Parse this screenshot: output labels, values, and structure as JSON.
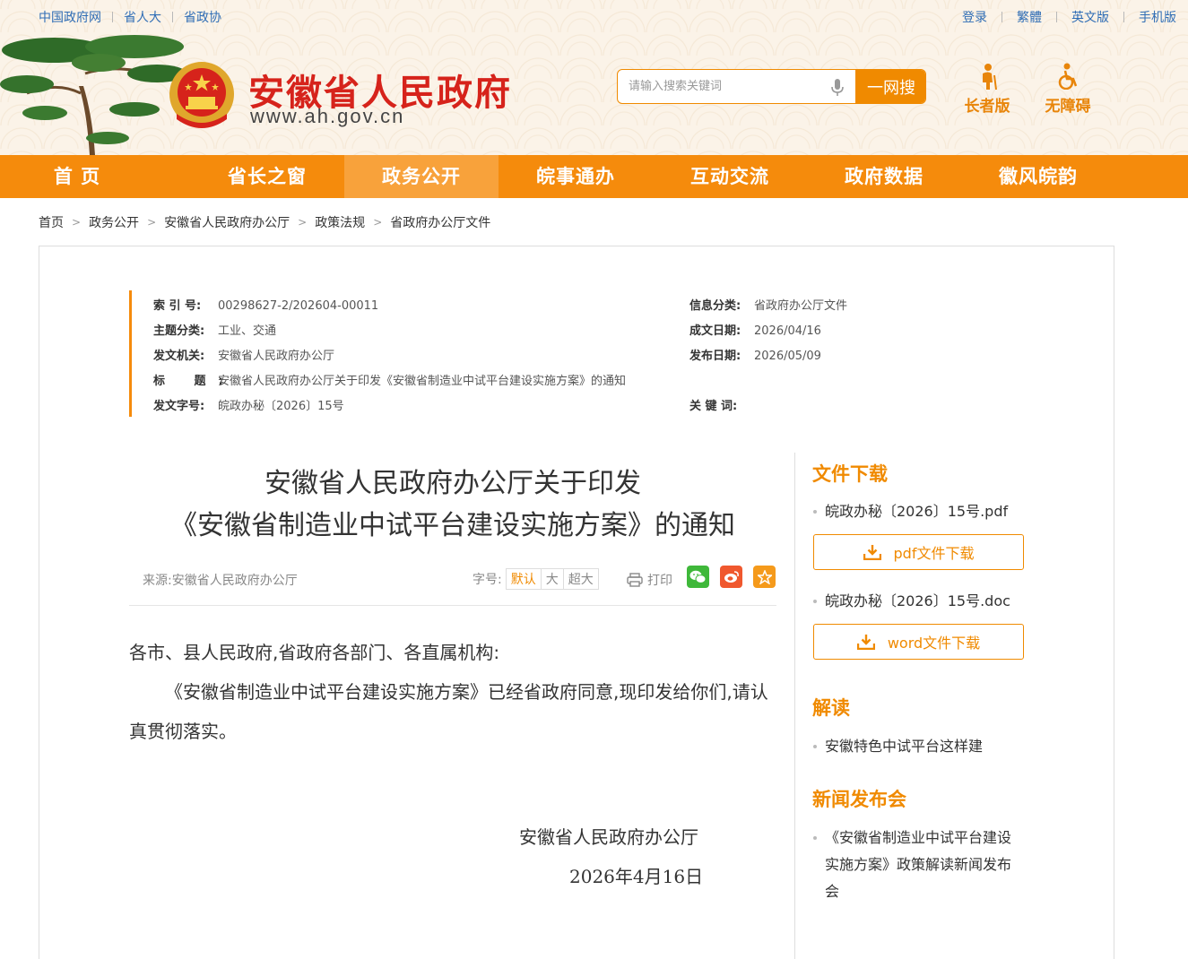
{
  "top_links_left": [
    "中国政府网",
    "省人大",
    "省政协"
  ],
  "top_links_right": [
    "登录",
    "繁體",
    "英文版",
    "手机版"
  ],
  "site": {
    "name": "安徽省人民政府",
    "url": "www.ah.gov.cn"
  },
  "search": {
    "placeholder": "请输入搜索关键词",
    "button": "一网搜"
  },
  "modes": {
    "elder": "长者版",
    "accessible": "无障碍"
  },
  "nav": {
    "items": [
      "首 页",
      "省长之窗",
      "政务公开",
      "皖事通办",
      "互动交流",
      "政府数据",
      "徽风皖韵"
    ],
    "active": "政务公开"
  },
  "breadcrumb": [
    "首页",
    "政务公开",
    "安徽省人民政府办公厅",
    "政策法规",
    "省政府办公厅文件"
  ],
  "meta": {
    "index_no": {
      "label": "索 引 号:",
      "value": "00298627-2/202604-00011"
    },
    "topic": {
      "label": "主题分类:",
      "value": "工业、交通"
    },
    "issuer": {
      "label": "发文机关:",
      "value": "安徽省人民政府办公厅"
    },
    "title": {
      "label": "标 题:",
      "value": "安徽省人民政府办公厅关于印发《安徽省制造业中试平台建设实施方案》的通知"
    },
    "doc_no": {
      "label": "发文字号:",
      "value": "皖政办秘〔2026〕15号"
    },
    "info_category": {
      "label": "信息分类:",
      "value": "省政府办公厅文件"
    },
    "created": {
      "label": "成文日期:",
      "value": "2026/04/16"
    },
    "published": {
      "label": "发布日期:",
      "value": "2026/05/09"
    },
    "keywords": {
      "label": "关 键 词:",
      "value": ""
    }
  },
  "article": {
    "title_line1": "安徽省人民政府办公厅关于印发",
    "title_line2": "《安徽省制造业中试平台建设实施方案》的通知",
    "source": "来源:安徽省人民政府办公厅",
    "font_size_label": "字号:",
    "font_sizes": [
      "默认",
      "大",
      "超大"
    ],
    "print": "打印",
    "salutation": "各市、县人民政府,省政府各部门、各直属机构:",
    "paragraph": "《安徽省制造业中试平台建设实施方案》已经省政府同意,现印发给你们,请认真贯彻落实。",
    "signer": "安徽省人民政府办公厅",
    "date": "2026年4月16日"
  },
  "sidebar": {
    "downloads_heading": "文件下载",
    "pdf_name": "皖政办秘〔2026〕15号.pdf",
    "pdf_button": "pdf文件下载",
    "doc_name": "皖政办秘〔2026〕15号.doc",
    "doc_button": "word文件下载",
    "interpret_heading": "解读",
    "interpret_item": "安徽特色中试平台这样建",
    "press_heading": "新闻发布会",
    "press_item": "《安徽省制造业中试平台建设实施方案》政策解读新闻发布会"
  },
  "colors": {
    "accent": "#f58b0c",
    "brand_red": "#d6231b",
    "link": "#2f6db5"
  },
  "icons": [
    "pine-tree-icon",
    "national-emblem-icon",
    "microphone-icon",
    "elder-icon",
    "wheelchair-icon",
    "printer-icon",
    "wechat-icon",
    "weibo-icon",
    "favorite-star-icon",
    "download-icon"
  ]
}
